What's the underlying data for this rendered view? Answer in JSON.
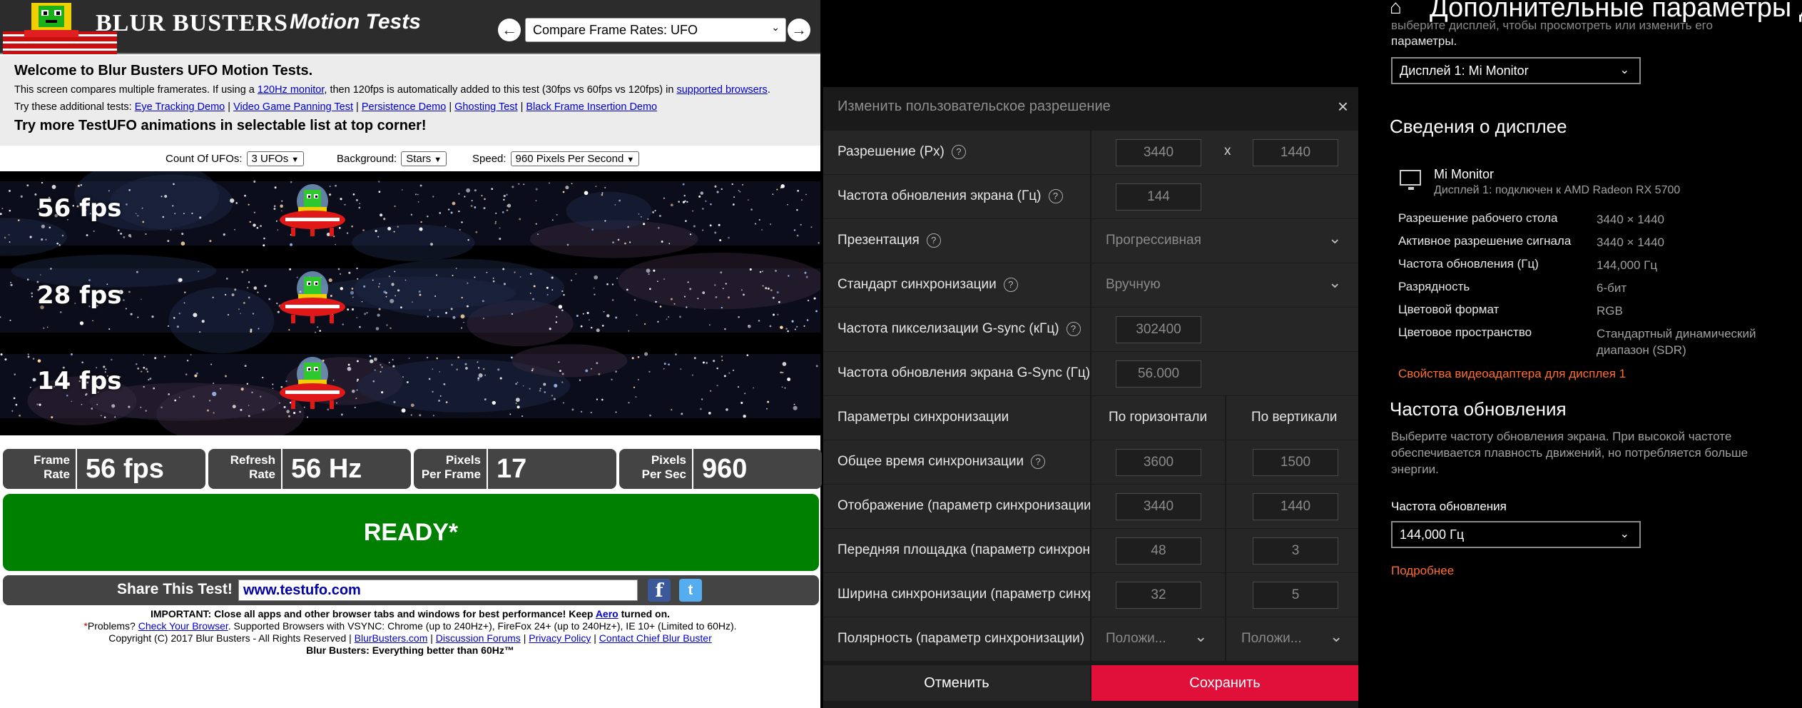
{
  "testufo": {
    "brand": "BLUR BUSTERS",
    "brand_sub": "Motion Tests",
    "test_select": "Compare Frame Rates: UFO",
    "welcome": {
      "title": "Welcome to Blur Busters UFO Motion Tests.",
      "line1_a": "This screen compares multiple framerates. If using a ",
      "line1_link1": "120Hz monitor",
      "line1_b": ", then 120fps is automatically added to this test (30fps vs 60fps vs 120fps) in ",
      "line1_link2": "supported browsers",
      "line1_c": ".",
      "line2_prefix": "Try these additional tests: ",
      "links": [
        "Eye Tracking Demo",
        "Video Game Panning Test",
        "Persistence Demo",
        "Ghosting Test",
        "Black Frame Insertion Demo"
      ],
      "title2": "Try more TestUFO animations in selectable list at top corner!"
    },
    "controls": {
      "count_label": "Count Of UFOs:",
      "count_value": "3 UFOs",
      "background_label": "Background:",
      "background_value": "Stars",
      "speed_label": "Speed:",
      "speed_value": "960 Pixels Per Second"
    },
    "lanes": [
      "56 fps",
      "28 fps",
      "14 fps"
    ],
    "stats": [
      {
        "label1": "Frame",
        "label2": "Rate",
        "value": "56 fps"
      },
      {
        "label1": "Refresh",
        "label2": "Rate",
        "value": "56 Hz"
      },
      {
        "label1": "Pixels",
        "label2": "Per Frame",
        "value": "17"
      },
      {
        "label1": "Pixels",
        "label2": "Per Sec",
        "value": "960"
      }
    ],
    "ready": "READY*",
    "share_label": "Share This Test!",
    "share_url": "www.testufo.com",
    "footer": {
      "imp_a": "IMPORTANT: Close all apps and other browser tabs and windows for best performance! Keep ",
      "imp_link": "Aero",
      "imp_b": " turned on.",
      "prob_star": "*",
      "prob_a": "Problems? ",
      "prob_link": "Check Your Browser",
      "prob_b": ". Supported Browsers with VSYNC: Chrome (up to 240Hz+), FireFox 24+ (up to 240Hz+), IE 10+ (Limited to 60Hz).",
      "copy_a": "Copyright (C) 2017 Blur Busters - All Rights Reserved | ",
      "copy_links": [
        "BlurBusters.com",
        "Discussion Forums",
        "Privacy Policy",
        "Contact Chief Blur Buster"
      ],
      "tagline": "Blur Busters: Everything better than 60Hz™"
    }
  },
  "dialog": {
    "title": "Изменить пользовательское разрешение",
    "close": "×",
    "resolution_label": "Разрешение (Px)",
    "res_w": "3440",
    "res_x": "x",
    "res_h": "1440",
    "refresh_label": "Частота обновления экрана (Гц)",
    "refresh_value": "144",
    "presentation_label": "Презентация",
    "presentation_value": "Прогрессивная",
    "sync_std_label": "Стандарт синхронизации",
    "sync_std_value": "Вручную",
    "pixclk_label": "Частота пикселизации G-sync (кГц)",
    "pixclk_value": "302400",
    "gsync_refresh_label": "Частота обновления экрана G-Sync (Гц)",
    "gsync_refresh_value": "56.000",
    "timing_label": "Параметры синхронизации",
    "col_h": "По горизонтали",
    "col_v": "По вертикали",
    "total_label": "Общее время синхронизации",
    "total_h": "3600",
    "total_v": "1500",
    "display_label": "Отображение (параметр синхронизации)",
    "display_h": "3440",
    "display_v": "1440",
    "front_label": "Передняя площадка (параметр синхронизации)",
    "front_h": "48",
    "front_v": "3",
    "width_label": "Ширина синхронизации (параметр синхронизации)",
    "width_h": "32",
    "width_v": "5",
    "polarity_label": "Полярность (параметр синхронизации)",
    "polarity_h": "Положи...",
    "polarity_v": "Положи...",
    "cancel": "Отменить",
    "save": "Сохранить"
  },
  "windows": {
    "title": "Дополнительные параметры дисплея",
    "intro_cut": "выберите дисплей, чтобы просмотреть или изменить его",
    "intro_2": "параметры.",
    "display_select": "Дисплей 1: Mi Monitor",
    "info_heading": "Сведения о дисплее",
    "monitor_name": "Mi Monitor",
    "monitor_sub": "Дисплей 1: подключен к AMD Radeon RX 5700",
    "kv": [
      {
        "k": "Разрешение рабочего стола",
        "v": "3440 × 1440"
      },
      {
        "k": "Активное разрешение сигнала",
        "v": "3440 × 1440"
      },
      {
        "k": "Частота обновления (Гц)",
        "v": "144,000 Гц"
      },
      {
        "k": "Разрядность",
        "v": "6-бит"
      },
      {
        "k": "Цветовой формат",
        "v": "RGB"
      },
      {
        "k": "Цветовое пространство",
        "v": "Стандартный динамический"
      }
    ],
    "color_space_line2": "диапазон (SDR)",
    "adapter_link": "Свойства видеоадаптера для дисплея 1",
    "refresh_heading": "Частота обновления",
    "refresh_desc": "Выберите частоту обновления экрана. При высокой частоте обеспечивается плавность движений, но потребляется больше энергии.",
    "refresh_label": "Частота обновления",
    "refresh_select": "144,000 Гц",
    "more_link": "Подробнее"
  },
  "colors": {
    "ready_green": "#008000",
    "save_red": "#e0103a",
    "win_link": "#ff6d2d"
  }
}
